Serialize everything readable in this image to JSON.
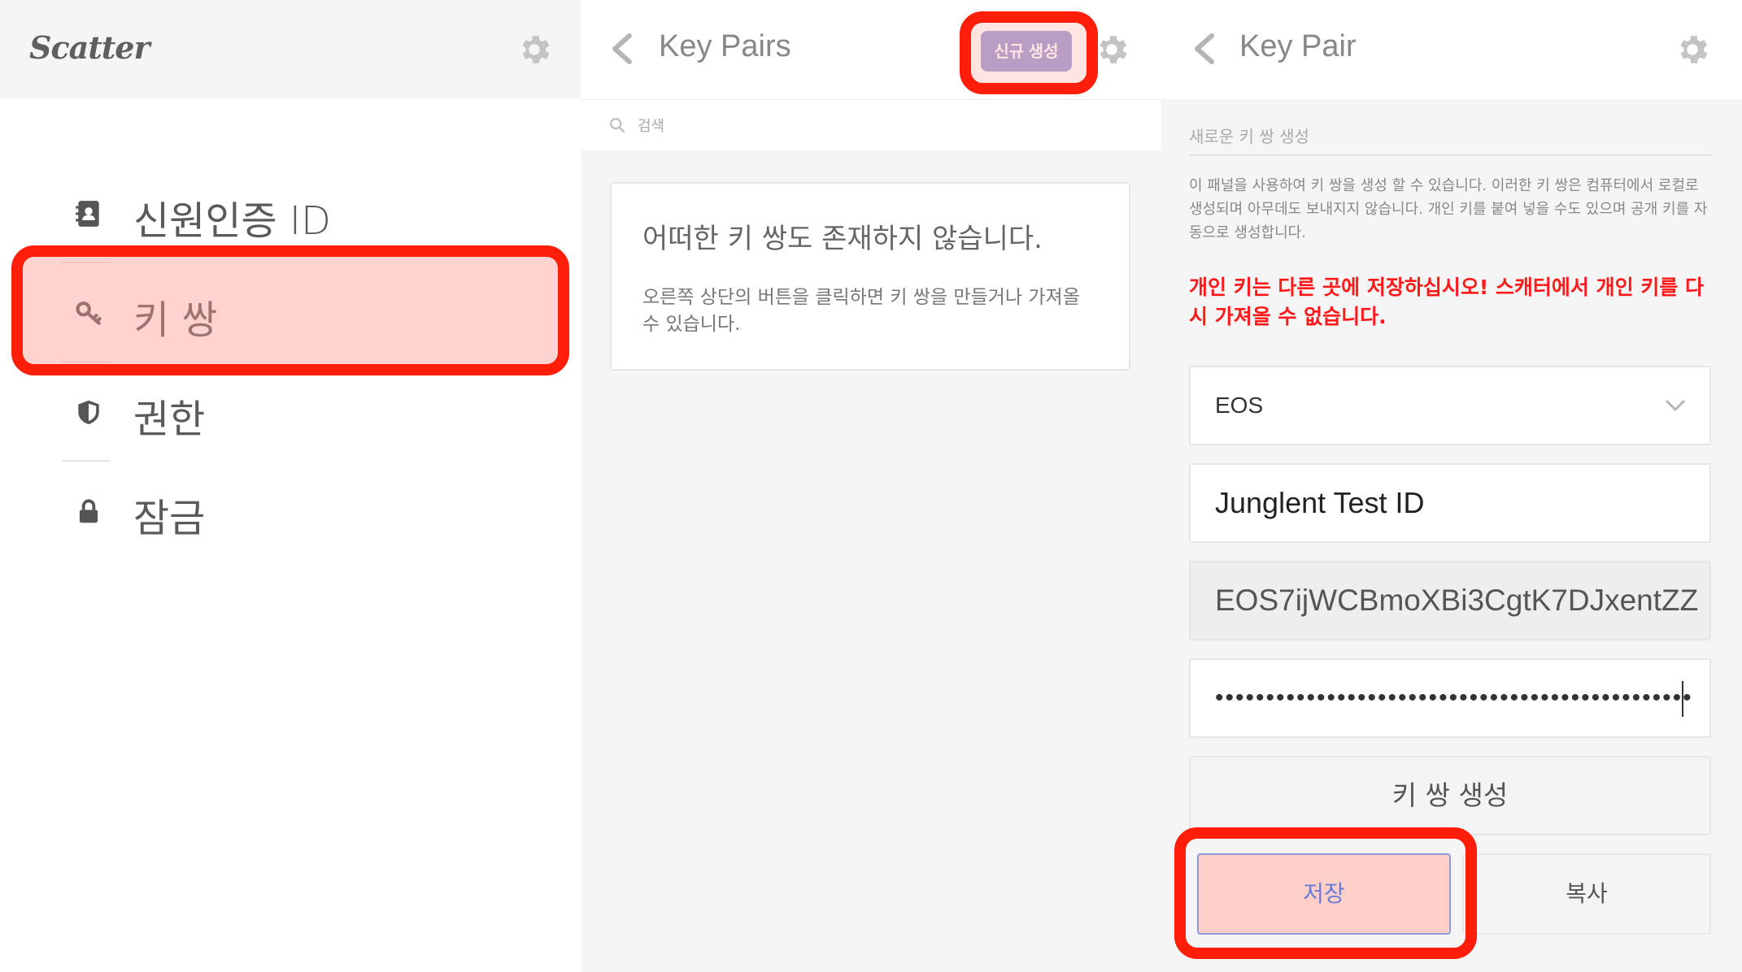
{
  "sidebar": {
    "logo": "Scatter",
    "items": [
      {
        "label": "신원인증 ID",
        "icon": "contact-book-icon"
      },
      {
        "label": "키 쌍",
        "icon": "key-icon"
      },
      {
        "label": "권한",
        "icon": "shield-icon"
      },
      {
        "label": "잠금",
        "icon": "lock-icon"
      }
    ]
  },
  "keypairs": {
    "title": "Key Pairs",
    "new_button": "신규 생성",
    "search_placeholder": "검색",
    "empty_title": "어떠한 키 쌍도 존재하지 않습니다.",
    "empty_text": "오른쪽 상단의 버튼을 클릭하면 키 쌍을 만들거나 가져올 수 있습니다."
  },
  "keypair": {
    "title": "Key Pair",
    "section_title": "새로운 키 쌍 생성",
    "description": "이 패널을 사용하여 키 쌍을 생성 할 수 있습니다. 이러한 키 쌍은 컴퓨터에서 로컬로 생성되며 아무데도 보내지지 않습니다. 개인 키를 붙여 넣을 수도 있으며 공개 키를 자동으로 생성합니다.",
    "warning": "개인 키는 다른 곳에 저장하십시오! 스캐터에서 개인 키를 다시 가져올 수 없습니다.",
    "blockchain": "EOS",
    "name": "Junglent Test ID",
    "public_key": "EOS7ijWCBmoXBi3CgtK7DJxentZZ",
    "private_key_mask": "•••••••••••••••••••••••••••••••••••••••••••••••",
    "generate_button": "키 쌍 생성",
    "save_button": "저장",
    "copy_button": "복사"
  },
  "colors": {
    "highlight": "#ff1e0a",
    "accent": "#a39fd9",
    "warning": "#ff1a1a"
  }
}
